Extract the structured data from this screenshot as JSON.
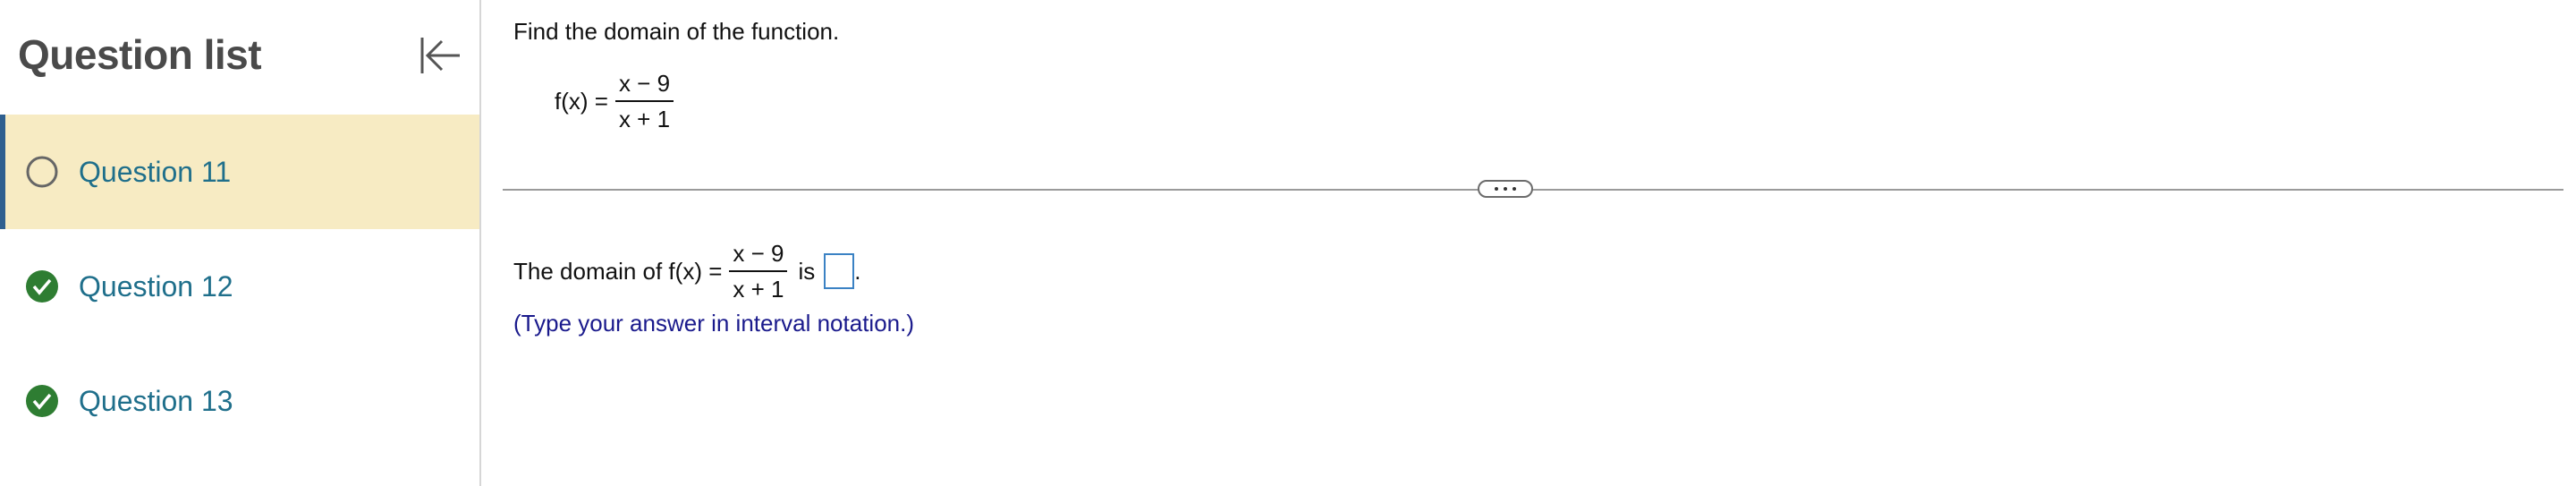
{
  "sidebar": {
    "title": "Question list",
    "collapse_icon": "collapse-left-icon",
    "items": [
      {
        "label": "Question 11",
        "status": "unanswered",
        "icon": "circle-outline-icon"
      },
      {
        "label": "Question 12",
        "status": "complete",
        "icon": "check-circle-icon"
      },
      {
        "label": "Question 13",
        "status": "complete",
        "icon": "check-circle-icon"
      }
    ]
  },
  "question": {
    "prompt": "Find the domain of the function.",
    "function_lhs": "f(x) =",
    "numerator": "x − 9",
    "denominator": "x + 1",
    "answer_prefix": "The domain of f(x) =",
    "answer_mid": "is",
    "answer_suffix": ".",
    "hint": "(Type your answer in interval notation.)"
  },
  "colors": {
    "active_bg": "#f7ebc3",
    "accent": "#2f5f8f",
    "link": "#1f6f8b",
    "check": "#2e7d32",
    "hint": "#1a1a8c",
    "input_border": "#3b82c4"
  }
}
